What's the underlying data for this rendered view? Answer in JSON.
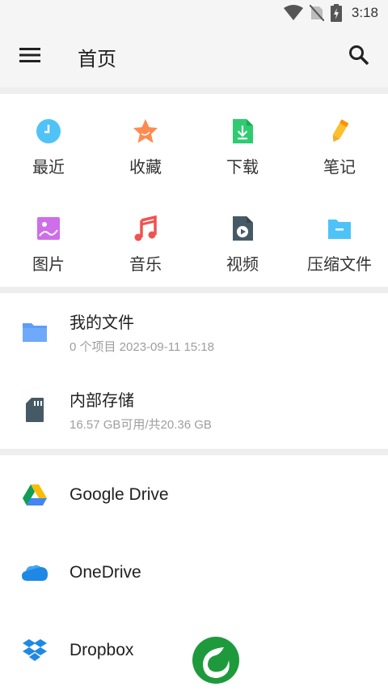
{
  "status_bar": {
    "time": "3:18",
    "icons": [
      "wifi-icon",
      "no-sim-icon",
      "battery-charging-icon"
    ]
  },
  "app_bar": {
    "title": "首页",
    "menu_icon": "hamburger-menu-icon",
    "search_icon": "search-icon"
  },
  "categories": [
    {
      "label": "最近",
      "icon": "clock-icon",
      "color": "#4fc3f7"
    },
    {
      "label": "收藏",
      "icon": "star-icon",
      "color": "#ff8a50"
    },
    {
      "label": "下载",
      "icon": "download-icon",
      "color": "#2ecc71"
    },
    {
      "label": "笔记",
      "icon": "pencil-icon",
      "color": "#fbc02d"
    },
    {
      "label": "图片",
      "icon": "image-icon",
      "color": "#ce6ee8"
    },
    {
      "label": "音乐",
      "icon": "music-icon",
      "color": "#ef5350"
    },
    {
      "label": "视频",
      "icon": "video-icon",
      "color": "#455a64"
    },
    {
      "label": "压缩文件",
      "icon": "archive-icon",
      "color": "#4fc3f7"
    }
  ],
  "storage": [
    {
      "title": "我的文件",
      "subtitle": "0 个项目 2023-09-11 15:18",
      "icon": "folder-icon",
      "color": "#5c9dfa"
    },
    {
      "title": "内部存储",
      "subtitle": "16.57 GB可用/共20.36 GB",
      "icon": "sd-card-icon",
      "color": "#455a64"
    }
  ],
  "cloud": [
    {
      "title": "Google Drive",
      "icon": "google-drive-icon"
    },
    {
      "title": "OneDrive",
      "icon": "onedrive-icon",
      "color": "#1e88e5"
    },
    {
      "title": "Dropbox",
      "icon": "dropbox-icon",
      "color": "#1e88e5"
    }
  ],
  "watermark": {
    "icon": "leaf-logo-icon",
    "color": "#1e9a3c"
  }
}
